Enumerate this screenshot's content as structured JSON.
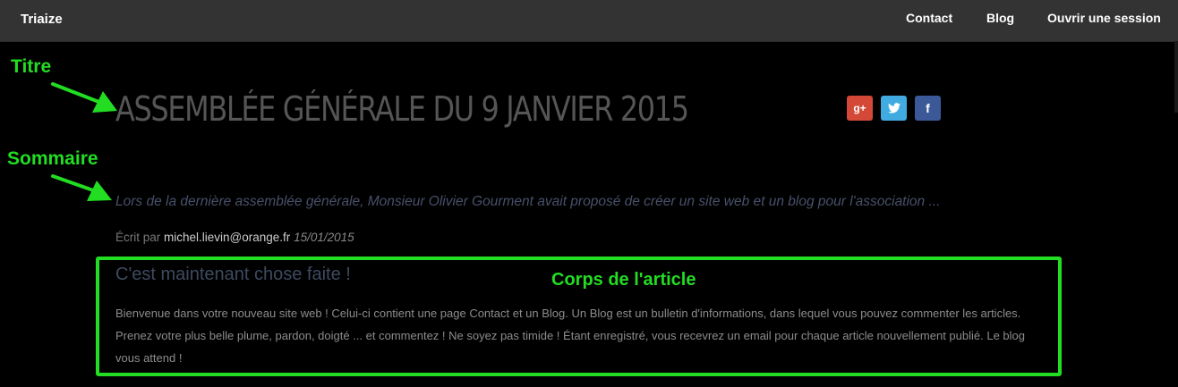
{
  "navbar": {
    "brand": "Triaize",
    "links": [
      {
        "label": "Contact"
      },
      {
        "label": "Blog"
      },
      {
        "label": "Ouvrir une session"
      }
    ]
  },
  "article": {
    "title": "ASSEMBLÉE GÉNÉRALE DU 9 JANVIER 2015",
    "summary": "Lors de la dernière assemblée générale, Monsieur Olivier Gourment avait proposé de créer un site web et un blog pour l'association ...",
    "byline": {
      "prefix": "Écrit par",
      "author": "michel.lievin@orange.fr",
      "date": "15/01/2015"
    },
    "body": {
      "heading": "C'est maintenant chose faite !",
      "text": "Bienvenue dans votre nouveau site web ! Celui-ci contient une page Contact et un Blog. Un Blog est un bulletin d'informations, dans lequel vous pouvez commenter les articles. Prenez votre plus belle plume, pardon, doigté ... et commentez ! Ne soyez pas timide ! Étant enregistré, vous recevrez un email pour chaque article nouvellement publié. Le blog vous attend !"
    }
  },
  "share": {
    "gplus": {
      "glyph": "g+",
      "color": "#d34836",
      "icon": "google-plus-icon"
    },
    "twitter": {
      "glyph": "t",
      "color": "#41abe1",
      "icon": "twitter-icon"
    },
    "facebook": {
      "glyph": "f",
      "color": "#3b5998",
      "icon": "facebook-icon"
    }
  },
  "annotations": {
    "title_label": "Titre",
    "summary_label": "Sommaire",
    "body_label": "Corps de l'article",
    "color": "#22dd22"
  }
}
